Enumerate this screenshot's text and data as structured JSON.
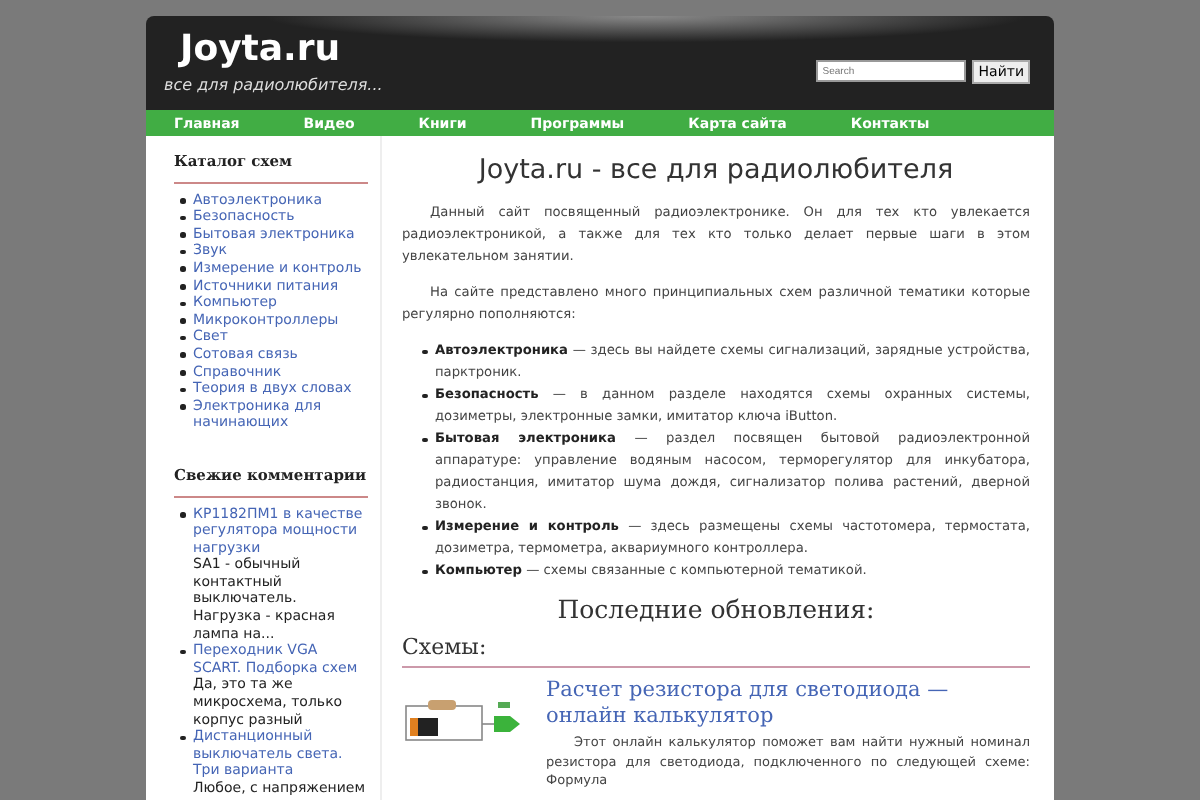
{
  "header": {
    "title": "Joyta.ru",
    "tagline": "все для радиолюбителя...",
    "search": {
      "placeholder": "Search",
      "button": "Найти"
    }
  },
  "nav": [
    "Главная",
    "Видео",
    "Книги",
    "Программы",
    "Карта сайта",
    "Контакты"
  ],
  "sidebar": {
    "catalog": {
      "title": "Каталог схем",
      "items": [
        "Автоэлектроника",
        "Безопасность",
        "Бытовая электроника",
        "Звук",
        "Измерение и контроль",
        "Источники питания",
        "Компьютер",
        "Микроконтроллеры",
        "Свет",
        "Сотовая связь",
        "Справочник",
        "Теория в двух словах",
        "Электроника для начинающих"
      ]
    },
    "comments": {
      "title": "Свежие комментарии",
      "items": [
        {
          "link": "КР1182ПМ1 в качестве регулятора мощности нагрузки",
          "text": "SA1 - обычный контактный выключатель. Нагрузка - красная лампа на..."
        },
        {
          "link": "Переходник VGA SCART. Подборка схем",
          "text": "Да, это та же микросхема, только корпус разный"
        },
        {
          "link": "Дистанционный выключатель света. Три варианта",
          "text": "Любое, с напряжением"
        }
      ]
    }
  },
  "main": {
    "title": "Joyta.ru - все для радиолюбителя",
    "paragraphs": [
      "Данный сайт посвященный радиоэлектронике. Он для тех кто увлекается радиоэлектроникой, а также для тех кто только делает первые шаги в этом увлекательном занятии.",
      "На сайте представлено много принципиальных схем различной тематики которые регулярно пополняются:"
    ],
    "sections": [
      "**Автоэлектроника** — здесь вы найдете схемы сигнализаций, зарядные устройства, парктроник.",
      "**Безопасность** — в данном разделе находятся схемы охранных системы, дозиметры, электронные замки, имитатор ключа iButton.",
      "**Бытовая электроника** — раздел посвящен бытовой радиоэлектронной аппаратуре: управление водяным насосом, терморегулятор для инкубатора, радиостанция, имитатор шума дождя, сигнализатор полива растений, дверной звонок.",
      "**Измерение и контроль** — здесь размещены схемы частотомера, термостата, дозиметра, термометра, аквариумного контроллера.",
      "**Компьютер** — схемы связанные с компьютерной тематикой."
    ],
    "updates_title": "Последние обновления:",
    "category": "Схемы:",
    "post": {
      "title": "Расчет резистора для светодиода — онлайн калькулятор",
      "excerpt": "Этот онлайн калькулятор поможет вам найти нужный номинал резистора для светодиода, подключенного по следующей схеме: Формула"
    }
  }
}
